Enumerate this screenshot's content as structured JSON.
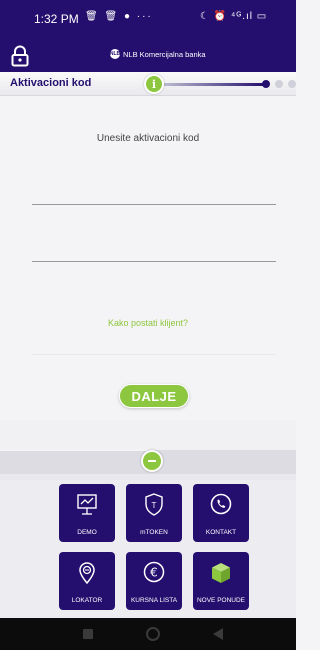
{
  "status_bar": {
    "time": "1:32 PM",
    "left_icons": "🗑 🗑 ● ···",
    "right_icons": "☾ ⏰ ⁴ᴳ.ıl ▭"
  },
  "header": {
    "brand": "NLB Komercijalna banka",
    "brand_logo_text": "NLB"
  },
  "step_bar": {
    "title": "Aktivacioni kod",
    "info_glyph": "i",
    "current_step": 1,
    "total_steps": 3
  },
  "form": {
    "prompt": "Unesite aktivacioni kod",
    "become_client_link": "Kako postati klijent?",
    "next_button": "DALJE"
  },
  "tiles": [
    {
      "label": "DEMO",
      "icon": "presentation-icon"
    },
    {
      "label": "mTOKEN",
      "icon": "shield-token-icon"
    },
    {
      "label": "KONTAKT",
      "icon": "phone-icon"
    },
    {
      "label": "LOKATOR",
      "icon": "location-pin-icon"
    },
    {
      "label": "KURSNA LISTA",
      "icon": "euro-icon"
    },
    {
      "label": "NOVE PONUDE",
      "icon": "gift-box-icon"
    }
  ],
  "colors": {
    "brand_purple": "#240f6e",
    "accent_green": "#8dc63f",
    "background": "#f4f4f6"
  }
}
